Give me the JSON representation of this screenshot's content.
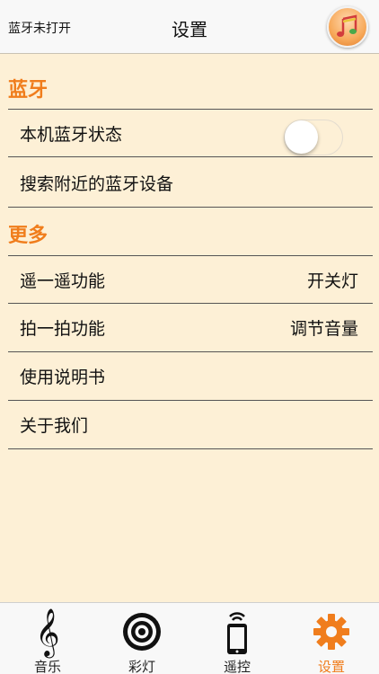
{
  "nav": {
    "status": "蓝牙未打开",
    "title": "设置",
    "music_icon": "music-note-icon"
  },
  "sections": {
    "bluetooth": {
      "header": "蓝牙",
      "state_label": "本机蓝牙状态",
      "toggle_on": false,
      "search_label": "搜索附近的蓝牙设备"
    },
    "more": {
      "header": "更多",
      "shake_label": "遥一遥功能",
      "shake_value": "开关灯",
      "pat_label": "拍一拍功能",
      "pat_value": "调节音量",
      "manual_label": "使用说明书",
      "about_label": "关于我们"
    }
  },
  "tabbar": {
    "music": "音乐",
    "lights": "彩灯",
    "remote": "遥控",
    "settings": "设置",
    "active": "settings"
  },
  "colors": {
    "accent": "#f07d1c",
    "background": "#fdf0d6"
  }
}
